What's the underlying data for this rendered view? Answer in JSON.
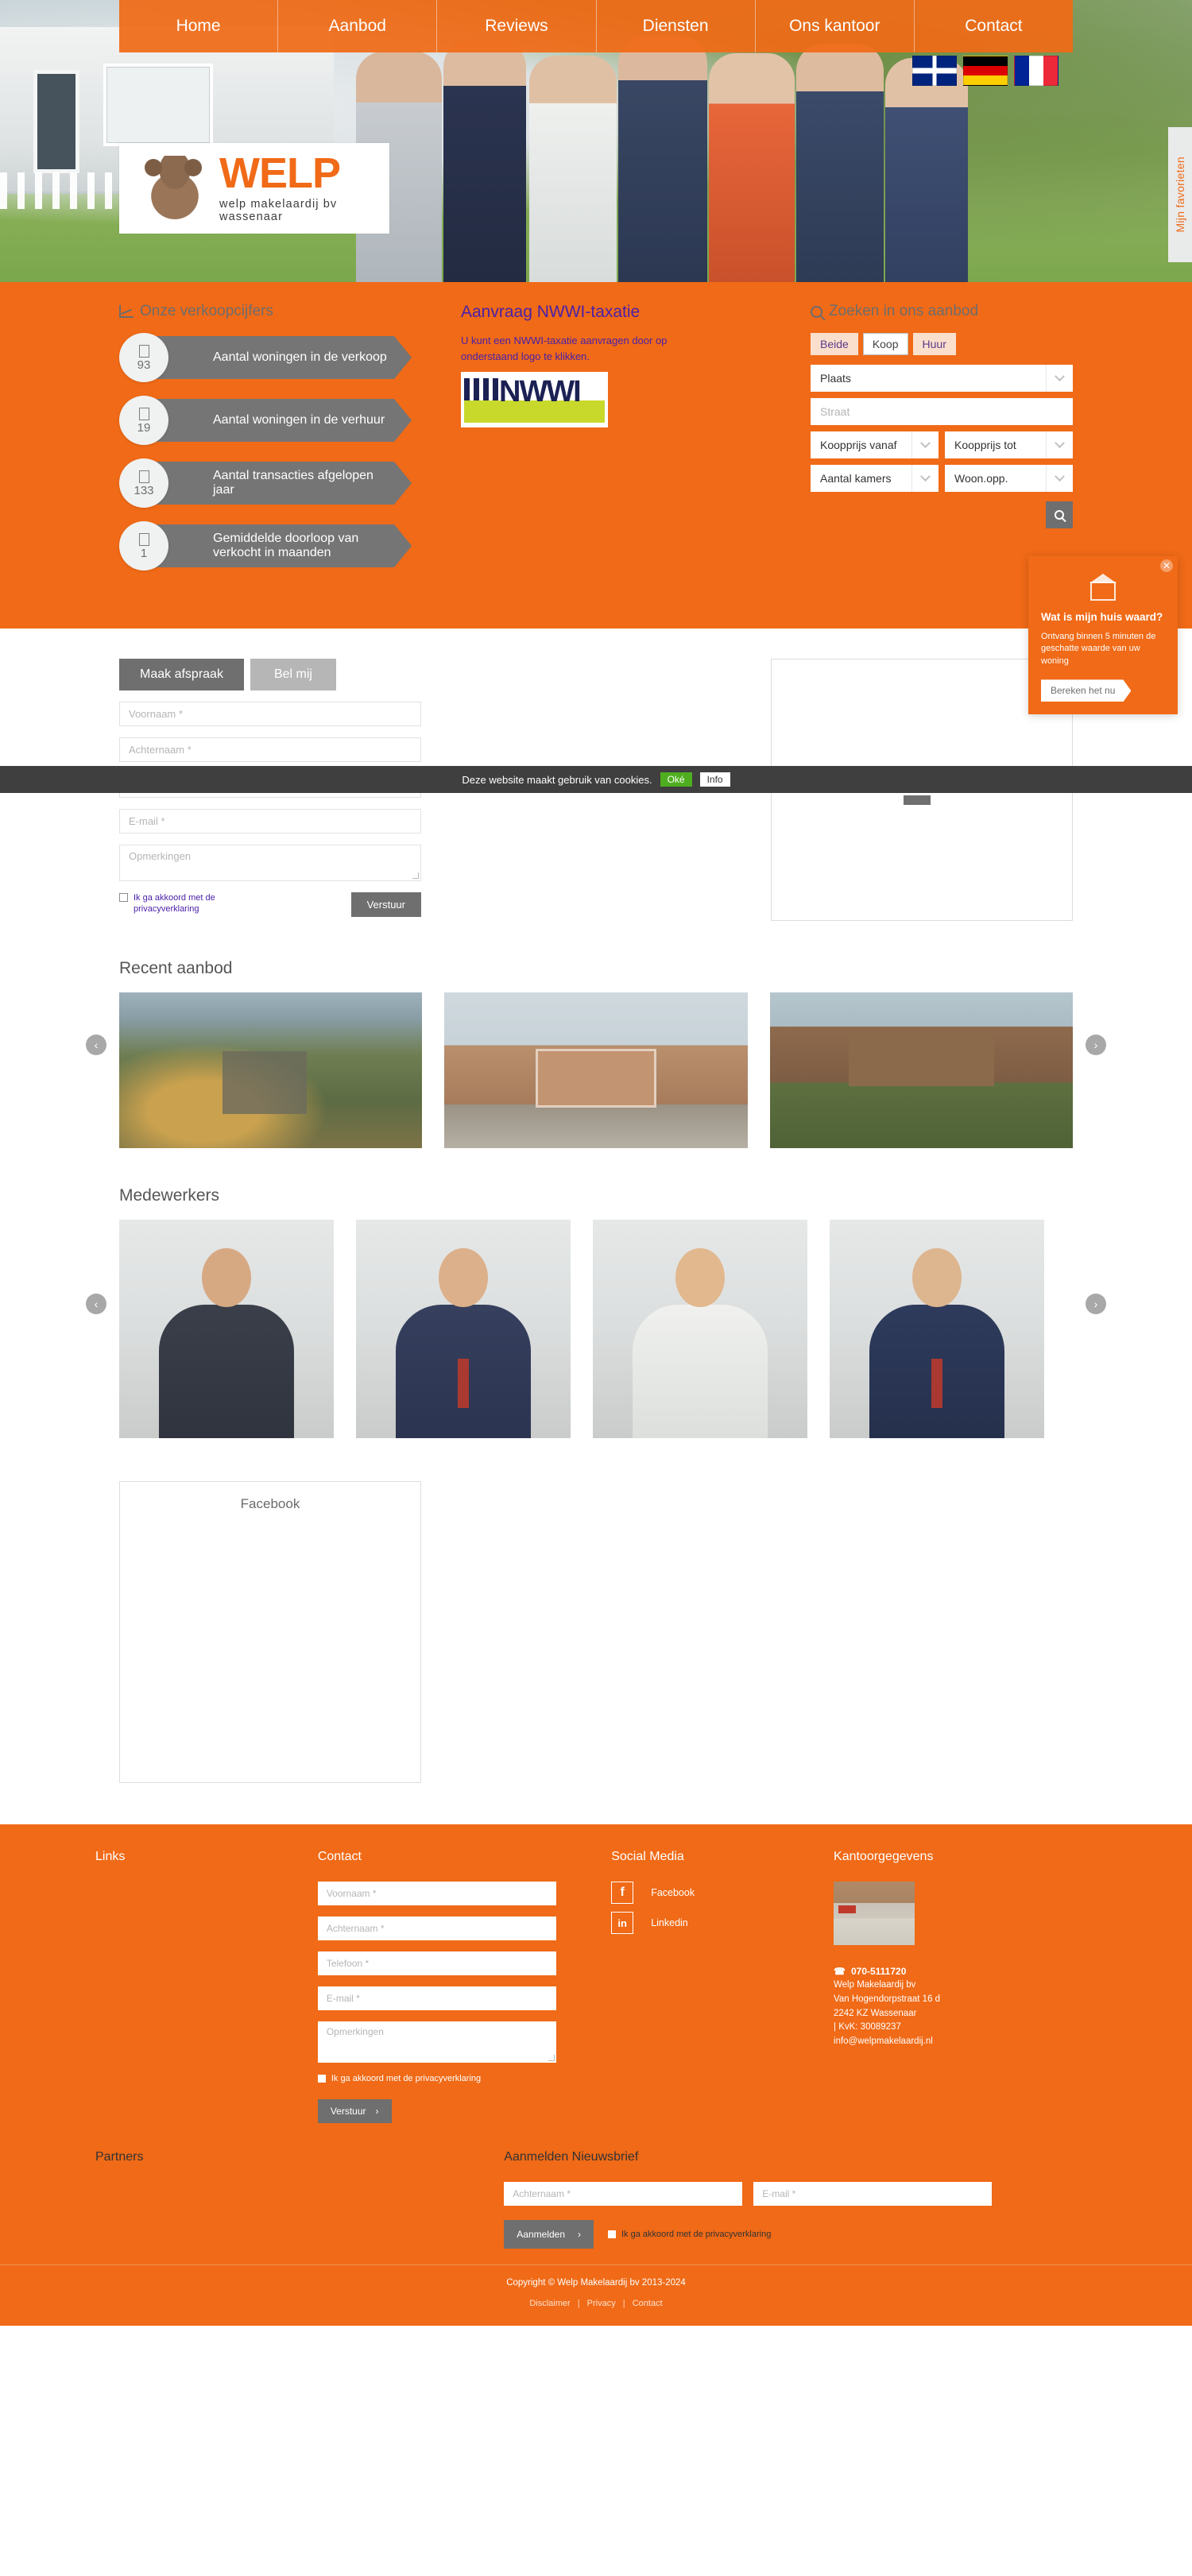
{
  "nav": {
    "items": [
      {
        "label": "Home"
      },
      {
        "label": "Aanbod"
      },
      {
        "label": "Reviews"
      },
      {
        "label": "Diensten"
      },
      {
        "label": "Ons kantoor"
      },
      {
        "label": "Contact"
      }
    ]
  },
  "flags": [
    {
      "name": "flag-uk"
    },
    {
      "name": "flag-de"
    },
    {
      "name": "flag-fr"
    }
  ],
  "logo": {
    "word": "WELP",
    "tagline": "welp makelaardij bv wassenaar"
  },
  "favorites_tab": {
    "label": "Mijn favorieten"
  },
  "stats": {
    "title": "Onze verkoopcijfers",
    "items": [
      {
        "value": "93",
        "label": "Aantal woningen in de verkoop"
      },
      {
        "value": "19",
        "label": "Aantal woningen in de verhuur"
      },
      {
        "value": "133",
        "label": "Aantal transacties afgelopen jaar"
      },
      {
        "value": "1",
        "label": "Gemiddelde doorloop van verkocht in maanden"
      }
    ]
  },
  "nwwi": {
    "title": "Aanvraag NWWI-taxatie",
    "text": "U kunt een NWWI-taxatie aanvragen door op onderstaand logo te klikken.",
    "logo_word": "NWWI"
  },
  "search": {
    "title": "Zoeken in ons aanbod",
    "types": [
      {
        "label": "Beide",
        "active": false
      },
      {
        "label": "Koop",
        "active": true
      },
      {
        "label": "Huur",
        "active": false
      }
    ],
    "place": "Plaats",
    "street": "Straat",
    "price_from": "Koopprijs vanaf",
    "price_to": "Koopprijs tot",
    "rooms": "Aantal kamers",
    "area": "Woon.opp."
  },
  "house_value": {
    "title": "Wat is mijn huis waard?",
    "body": "Ontvang binnen 5 minuten de geschatte waarde van uw woning",
    "cta": "Bereken het nu"
  },
  "cookiebar": {
    "text": "Deze website maakt gebruik van cookies.",
    "ok": "Oké",
    "info": "Info"
  },
  "contact_form": {
    "tab_appointment": "Maak afspraak",
    "tab_callme": "Bel mij",
    "firstname": "Voornaam *",
    "lastname": "Achternaam *",
    "phone": "Telefoon *",
    "email": "E-mail *",
    "remarks": "Opmerkingen",
    "agree": "Ik ga akkoord met de privacyverklaring",
    "submit": "Verstuur"
  },
  "recent": {
    "title": "Recent aanbod",
    "prev": "‹",
    "next": "›"
  },
  "staff": {
    "title": "Medewerkers",
    "prev": "‹",
    "next": "›"
  },
  "facebook": {
    "title": "Facebook"
  },
  "footer": {
    "links_head": "Links",
    "contact_head": "Contact",
    "social_head": "Social Media",
    "office_head": "Kantoorgegevens",
    "form": {
      "firstname": "Voornaam *",
      "lastname": "Achternaam *",
      "phone": "Telefoon *",
      "email": "E-mail *",
      "remarks": "Opmerkingen",
      "agree": "Ik ga akkoord met de privacyverklaring",
      "submit": "Verstuur",
      "submit_arrow": "›"
    },
    "social": [
      {
        "label": "Facebook",
        "glyph": "f"
      },
      {
        "label": "Linkedin",
        "glyph": "in"
      }
    ],
    "office": {
      "phone": "070-5111720",
      "company": "Welp Makelaardij bv",
      "street": "Van Hogendorpstraat 16 d",
      "city": "2242 KZ Wassenaar",
      "kvk": "| KvK: 30089237",
      "email": "info@welpmakelaardij.nl"
    }
  },
  "partners": {
    "head": "Partners",
    "newsletter_head": "Aanmelden Nieuwsbrief",
    "lastname": "Achternaam *",
    "email": "E-mail *",
    "agree": "Ik ga akkoord met de privacyverklaring",
    "submit": "Aanmelden",
    "submit_arrow": "›"
  },
  "copyright": {
    "text": "Copyright © Welp Makelaardij bv 2013-2024",
    "links": [
      {
        "label": "Disclaimer"
      },
      {
        "label": "Privacy"
      },
      {
        "label": "Contact"
      }
    ],
    "sep": "|"
  }
}
